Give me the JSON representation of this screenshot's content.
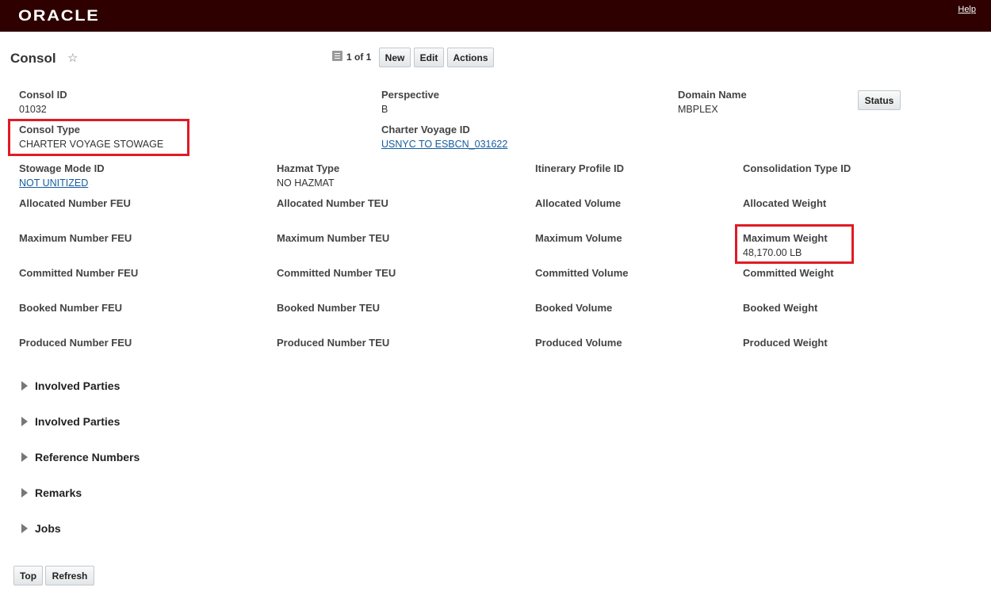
{
  "header": {
    "logo": "ORACLE",
    "help": "Help"
  },
  "title": {
    "text": "Consol",
    "star_icon": "☆"
  },
  "toolbar": {
    "pager_icon": "list-icon",
    "pager": "1 of 1",
    "new_label": "New",
    "edit_label": "Edit",
    "actions_label": "Actions",
    "status_label": "Status"
  },
  "fields": {
    "consol_id": {
      "label": "Consol ID",
      "value": "01032"
    },
    "perspective": {
      "label": "Perspective",
      "value": "B"
    },
    "domain_name": {
      "label": "Domain Name",
      "value": "MBPLEX"
    },
    "consol_type": {
      "label": "Consol Type",
      "value": "CHARTER VOYAGE STOWAGE"
    },
    "charter_voyage_id": {
      "label": "Charter Voyage ID",
      "value": "USNYC TO ESBCN_031622"
    },
    "stowage_mode_id": {
      "label": "Stowage Mode ID",
      "value": "NOT UNITIZED"
    },
    "hazmat_type": {
      "label": "Hazmat Type",
      "value": "NO HAZMAT"
    },
    "itinerary_profile_id": {
      "label": "Itinerary Profile ID",
      "value": ""
    },
    "consolidation_type_id": {
      "label": "Consolidation Type ID",
      "value": ""
    },
    "allocated_number_feu": {
      "label": "Allocated Number FEU",
      "value": ""
    },
    "allocated_number_teu": {
      "label": "Allocated Number TEU",
      "value": ""
    },
    "allocated_volume": {
      "label": "Allocated Volume",
      "value": ""
    },
    "allocated_weight": {
      "label": "Allocated Weight",
      "value": ""
    },
    "maximum_number_feu": {
      "label": "Maximum Number FEU",
      "value": ""
    },
    "maximum_number_teu": {
      "label": "Maximum Number TEU",
      "value": ""
    },
    "maximum_volume": {
      "label": "Maximum Volume",
      "value": ""
    },
    "maximum_weight": {
      "label": "Maximum Weight",
      "value": "48,170.00 LB"
    },
    "committed_number_feu": {
      "label": "Committed Number FEU",
      "value": ""
    },
    "committed_number_teu": {
      "label": "Committed Number TEU",
      "value": ""
    },
    "committed_volume": {
      "label": "Committed Volume",
      "value": ""
    },
    "committed_weight": {
      "label": "Committed Weight",
      "value": ""
    },
    "booked_number_feu": {
      "label": "Booked Number FEU",
      "value": ""
    },
    "booked_number_teu": {
      "label": "Booked Number TEU",
      "value": ""
    },
    "booked_volume": {
      "label": "Booked Volume",
      "value": ""
    },
    "booked_weight": {
      "label": "Booked Weight",
      "value": ""
    },
    "produced_number_feu": {
      "label": "Produced Number FEU",
      "value": ""
    },
    "produced_number_teu": {
      "label": "Produced Number TEU",
      "value": ""
    },
    "produced_volume": {
      "label": "Produced Volume",
      "value": ""
    },
    "produced_weight": {
      "label": "Produced Weight",
      "value": ""
    }
  },
  "sections": [
    {
      "label": "Involved Parties"
    },
    {
      "label": "Involved Parties"
    },
    {
      "label": "Reference Numbers"
    },
    {
      "label": "Remarks"
    },
    {
      "label": "Jobs"
    }
  ],
  "footer": {
    "top_label": "Top",
    "refresh_label": "Refresh"
  },
  "colors": {
    "header_bg": "#2e0000",
    "highlight": "#e01b24",
    "link": "#145c9e"
  }
}
